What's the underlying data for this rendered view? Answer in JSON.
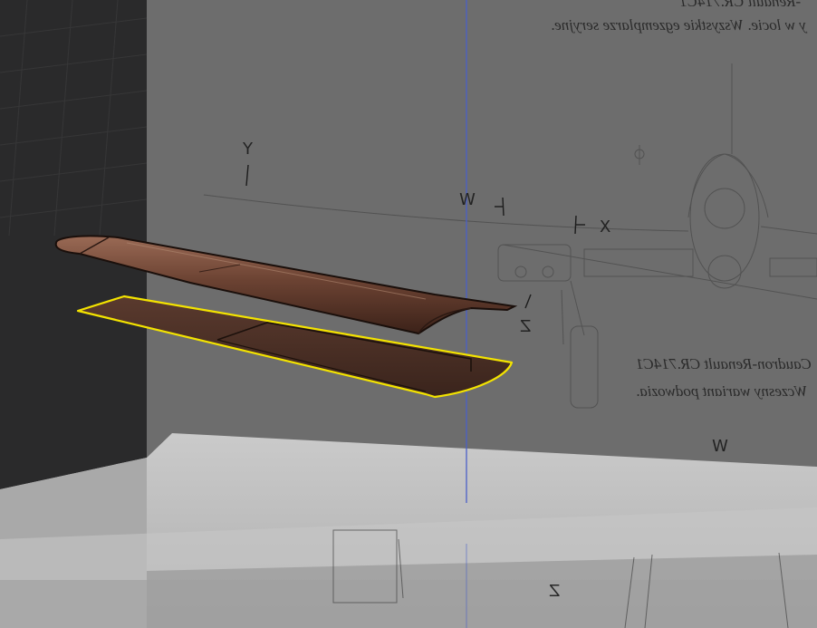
{
  "viewport": {
    "mode": "3D viewport",
    "selection_outline_color": "#f3e300",
    "wing_color": "#6a4030",
    "reference_bg_color": "#6d6d6d",
    "ground_plane_color": "#bdbdbd"
  },
  "reference_texts": {
    "top_line_1": "-Renault CR.714C1",
    "top_line_2": "y w locie. Wszystkie egzemplarze seryjne.",
    "mid_line_1": "Caudron-Renault CR.714C1",
    "mid_line_2": "Wczesny wariant podwozia."
  },
  "axis_labels": {
    "y_top": "Y",
    "w_upper": "W",
    "x_label": "X",
    "z_upper": "Z",
    "w_lower": "W",
    "z_lower": "Z"
  },
  "icons": {
    "selection": "selection-outline-icon"
  }
}
